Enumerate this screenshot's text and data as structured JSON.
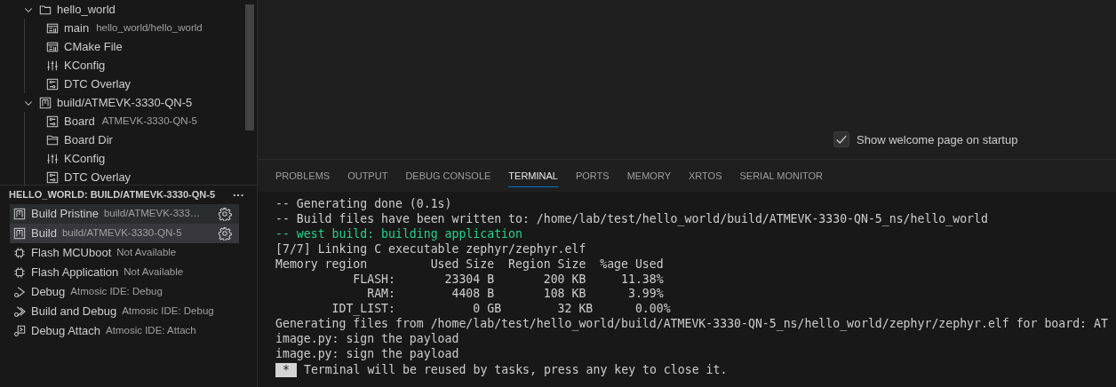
{
  "tree": [
    {
      "label": "hello_world",
      "kind": "folder",
      "expanded": true,
      "children": [
        {
          "label": "main",
          "description": "hello_world/hello_world",
          "kind": "cmake"
        },
        {
          "label": "CMake File",
          "kind": "cmake"
        },
        {
          "label": "KConfig",
          "kind": "kconfig"
        },
        {
          "label": "DTC Overlay",
          "kind": "dtc"
        }
      ]
    },
    {
      "label": "build/ATMEVK-3330-QN-5",
      "kind": "build",
      "expanded": true,
      "children": [
        {
          "label": "Board",
          "description": "ATMEVK-3330-QN-5",
          "kind": "dtc"
        },
        {
          "label": "Board Dir",
          "kind": "boarddir"
        },
        {
          "label": "KConfig",
          "kind": "kconfig"
        },
        {
          "label": "DTC Overlay",
          "kind": "dtc"
        }
      ]
    }
  ],
  "tasks_section": {
    "title": "HELLO_WORLD: BUILD/ATMEVK-3330-QN-5",
    "more": "···",
    "tasks": [
      {
        "label": "Build Pristine",
        "description": "build/ATMEVK-333…",
        "kind": "build",
        "selected": false,
        "hovered": true,
        "settings": true
      },
      {
        "label": "Build",
        "description": "build/ATMEVK-3330-QN-5",
        "kind": "build",
        "selected": true,
        "hovered": false,
        "settings": true
      },
      {
        "label": "Flash MCUboot",
        "description": "Not Available",
        "kind": "chip",
        "selected": false,
        "hovered": false,
        "settings": false
      },
      {
        "label": "Flash Application",
        "description": "Not Available",
        "kind": "chip",
        "selected": false,
        "hovered": false,
        "settings": false
      },
      {
        "label": "Debug",
        "description": "Atmosic IDE: Debug",
        "kind": "debug",
        "selected": false,
        "hovered": false,
        "settings": false
      },
      {
        "label": "Build and Debug",
        "description": "Atmosic IDE: Debug",
        "kind": "builddebug",
        "selected": false,
        "hovered": false,
        "settings": false
      },
      {
        "label": "Debug Attach",
        "description": "Atmosic IDE: Attach",
        "kind": "attach",
        "selected": false,
        "hovered": false,
        "settings": false
      }
    ]
  },
  "welcome": {
    "label": "Show welcome page on startup",
    "checked": true
  },
  "panel_tabs": [
    {
      "label": "PROBLEMS",
      "selected": false
    },
    {
      "label": "OUTPUT",
      "selected": false
    },
    {
      "label": "DEBUG CONSOLE",
      "selected": false
    },
    {
      "label": "TERMINAL",
      "selected": true
    },
    {
      "label": "PORTS",
      "selected": false
    },
    {
      "label": "MEMORY",
      "selected": false
    },
    {
      "label": "XRTOS",
      "selected": false
    },
    {
      "label": "SERIAL MONITOR",
      "selected": false
    }
  ],
  "terminal": {
    "lines": [
      {
        "text": "-- Generating done (0.1s)",
        "kind": "normal"
      },
      {
        "text": "-- Build files have been written to: /home/lab/test/hello_world/build/ATMEVK-3330-QN-5_ns/hello_world",
        "kind": "normal"
      },
      {
        "text": "-- west build: building application",
        "kind": "success"
      },
      {
        "text": "[7/7] Linking C executable zephyr/zephyr.elf",
        "kind": "normal"
      },
      {
        "text": "Memory region         Used Size  Region Size  %age Used",
        "kind": "normal"
      },
      {
        "text": "           FLASH:       23304 B       200 KB     11.38%",
        "kind": "normal"
      },
      {
        "text": "             RAM:        4408 B       108 KB      3.99%",
        "kind": "normal"
      },
      {
        "text": "        IDT_LIST:           0 GB        32 KB      0.00%",
        "kind": "normal"
      },
      {
        "text": "Generating files from /home/lab/test/hello_world/build/ATMEVK-3330-QN-5_ns/hello_world/zephyr/zephyr.elf for board: AT",
        "kind": "normal"
      },
      {
        "text": "image.py: sign the payload",
        "kind": "normal"
      },
      {
        "text": "image.py: sign the payload",
        "kind": "normal"
      }
    ],
    "footer_badge": "*",
    "footer": "Terminal will be reused by tasks, press any key to close it."
  }
}
